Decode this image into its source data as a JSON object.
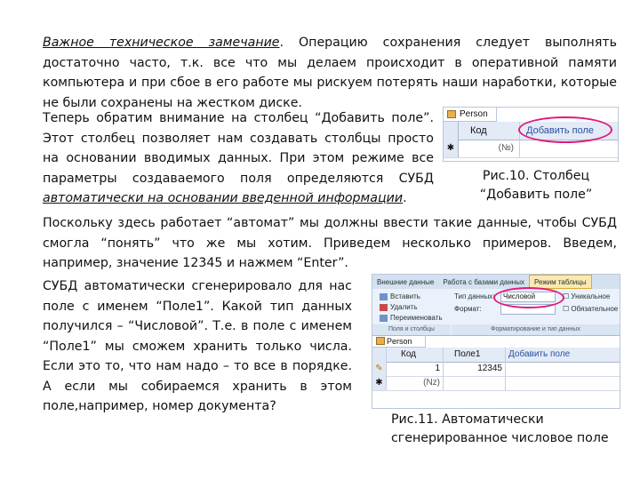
{
  "para1": {
    "underlined": "Важное техническое замечание",
    "rest": ". Операцию сохранения следует выполнять достаточно часто, т.к. все что мы делаем происходит в оперативной памяти компьютера и при сбое в его работе мы рискуем потерять наши наработки, которые не были сохранены на жестком диске."
  },
  "para2": {
    "text": "Теперь обратим внимание на столбец “Добавить поле”. Этот столбец позволяет нам создавать столбцы просто на основании вводимых данных. При этом режиме все параметры создаваемого поля определяются СУБД ",
    "underlined": "автоматически на основании введенной информации",
    "end": "."
  },
  "fig10": {
    "table_tab": "Person",
    "columns": [
      "Код",
      "Добавить поле"
    ],
    "new_row_marker": "✱",
    "new_row_value": "(№)",
    "caption": "Рис.10. Столбец “Добавить поле”"
  },
  "para3": "Поскольку здесь работает “автомат” мы должны ввести такие данные, чтобы СУБД смогла “понять” что же мы хотим. Приведем несколько примеров. Введем, например, значение 12345 и нажмем “Enter”.",
  "para4": "СУБД автоматически сгенерировало для нас поле с именем “Поле1”. Какой тип данных получился – “Числовой”. Т.е. в поле с именем “Поле1” мы сможем хранить только числа. Если это то, что нам надо – то все в порядке. А если мы собираемся хранить в этом поле,например, номер документа?",
  "fig11": {
    "ribbon_tabs": [
      "Внешние данные",
      "Работа с базами данных",
      "Режим таблицы"
    ],
    "buttons": [
      "Вставить",
      "Удалить",
      "Переименовать"
    ],
    "data_type_label": "Тип данных:",
    "data_type_value": "Числовой",
    "format_label": "Формат:",
    "checkboxes": [
      "Уникальное",
      "Обязательное"
    ],
    "groups": [
      "Поля и столбцы",
      "Форматирование и тип данных"
    ],
    "table_tab": "Person",
    "columns": [
      "Код",
      "Поле1",
      "Добавить поле"
    ],
    "rows": [
      {
        "marker": "✎",
        "id": "1",
        "value": "12345"
      },
      {
        "marker": "✱",
        "id": "(Nz)",
        "value": ""
      }
    ],
    "caption_line1": "Рис.11. Автоматически",
    "caption_line2": "сгенерированное числовое поле"
  }
}
